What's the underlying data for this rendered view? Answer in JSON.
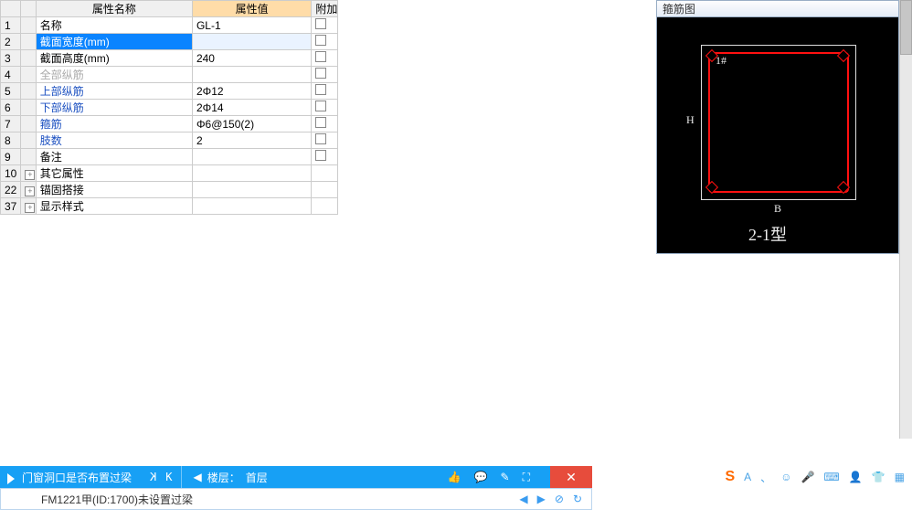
{
  "table": {
    "headers": {
      "name": "属性名称",
      "value": "属性值",
      "add": "附加"
    },
    "rows": [
      {
        "num": "1",
        "name": "名称",
        "value": "GL-1",
        "style": "plain",
        "chk": true
      },
      {
        "num": "2",
        "name": "截面宽度(mm)",
        "value": "",
        "style": "sel",
        "chk": true
      },
      {
        "num": "3",
        "name": "截面高度(mm)",
        "value": "240",
        "style": "plain",
        "chk": true
      },
      {
        "num": "4",
        "name": "全部纵筋",
        "value": "",
        "style": "gray",
        "chk": true
      },
      {
        "num": "5",
        "name": "上部纵筋",
        "value": "2Φ12",
        "style": "link",
        "chk": true
      },
      {
        "num": "6",
        "name": "下部纵筋",
        "value": "2Φ14",
        "style": "link",
        "chk": true
      },
      {
        "num": "7",
        "name": "箍筋",
        "value": "Φ6@150(2)",
        "style": "link",
        "chk": true
      },
      {
        "num": "8",
        "name": "肢数",
        "value": "2",
        "style": "link",
        "chk": true
      },
      {
        "num": "9",
        "name": "备注",
        "value": "",
        "style": "plain",
        "chk": true
      },
      {
        "num": "10",
        "name": "其它属性",
        "value": "",
        "style": "plain",
        "exp": true
      },
      {
        "num": "22",
        "name": "锚固搭接",
        "value": "",
        "style": "plain",
        "exp": true
      },
      {
        "num": "37",
        "name": "显示样式",
        "value": "",
        "style": "plain",
        "exp": true
      }
    ]
  },
  "diagram": {
    "title": "箍筋图",
    "label1": "1#",
    "labelH": "H",
    "labelB": "B",
    "type": "2-1型"
  },
  "infoBar": {
    "title": "门窗洞口是否布置过梁",
    "navPrev": "K",
    "navNext": "K",
    "floorLabel": "楼层：",
    "floorValue": "首层",
    "tool1": "👍",
    "tool2": "💬",
    "tool3": "✎",
    "tool4": "⛶",
    "close": "✕"
  },
  "subBar": {
    "text": "FM1221甲(ID:1700)未设置过梁",
    "t1": "◀",
    "t2": "▶",
    "t3": "⊘",
    "t4": "↻"
  },
  "ime": {
    "logo": "S",
    "items": [
      "A",
      "、",
      "☺",
      "🎤",
      "⌨",
      "👤",
      "👕",
      "▦"
    ]
  }
}
